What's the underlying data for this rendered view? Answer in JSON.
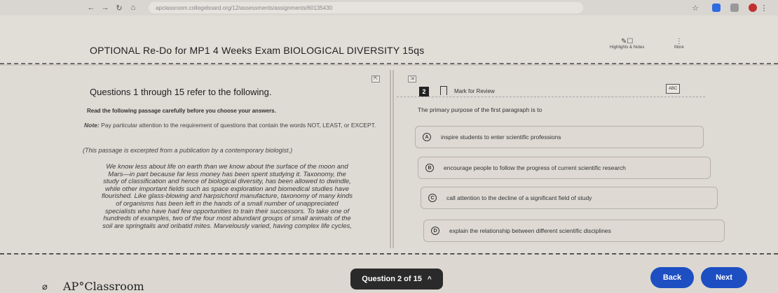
{
  "browser": {
    "url": "apclassroom.collegeboard.org/12/assessments/assignments/60135430"
  },
  "header": {
    "title": "OPTIONAL Re-Do for MP1 4 Weeks Exam BIOLOGICAL DIVERSITY 15qs",
    "highlights_label": "Highlights & Notes",
    "more_label": "More"
  },
  "passage_pane": {
    "question_range": "Questions 1 through 15 refer to the following.",
    "instructions": "Read the following passage carefully before you choose your answers.",
    "note_lead": "Note:",
    "note_text": " Pay particular attention to the requirement of questions that contain the words NOT, LEAST, or EXCEPT.",
    "source": "(This passage is excerpted from a publication by a contemporary biologist.)",
    "passage_lines": [
      "We know less about life on earth than we know about the surface of the moon and",
      "Mars—in part because far less money has been spent studying it. Taxonomy, the",
      "study of classification and hence of biological diversity, has been allowed to dwindle,",
      "while other important fields such as space exploration and biomedical studies have",
      "flourished. Like glass-blowing and harpsichord manufacture, taxonomy of many kinds",
      "of organisms has been left in the hands of a small number of unappreciated",
      "specialists who have had few opportunities to train their successors. To take one of",
      "hundreds of examples, two of the four most abundant groups of small animals of the",
      "soil are springtails and oribatid mites. Marvelously varied, having complex life cycles,"
    ]
  },
  "question_pane": {
    "number": "2",
    "mark_for_review": "Mark for Review",
    "abc_label": "ABC",
    "stem": "The primary purpose of the first paragraph is to",
    "choices": [
      {
        "letter": "A",
        "text": "inspire students to enter scientific professions"
      },
      {
        "letter": "B",
        "text": "encourage people to follow the progress of current scientific research"
      },
      {
        "letter": "C",
        "text": "call attention to the decline of a significant field of study"
      },
      {
        "letter": "D",
        "text": "explain the relationship between different scientific disciplines"
      }
    ]
  },
  "footer": {
    "logo": "AP°Classroom",
    "question_nav": "Question 2 of 15",
    "back_label": "Back",
    "next_label": "Next"
  }
}
